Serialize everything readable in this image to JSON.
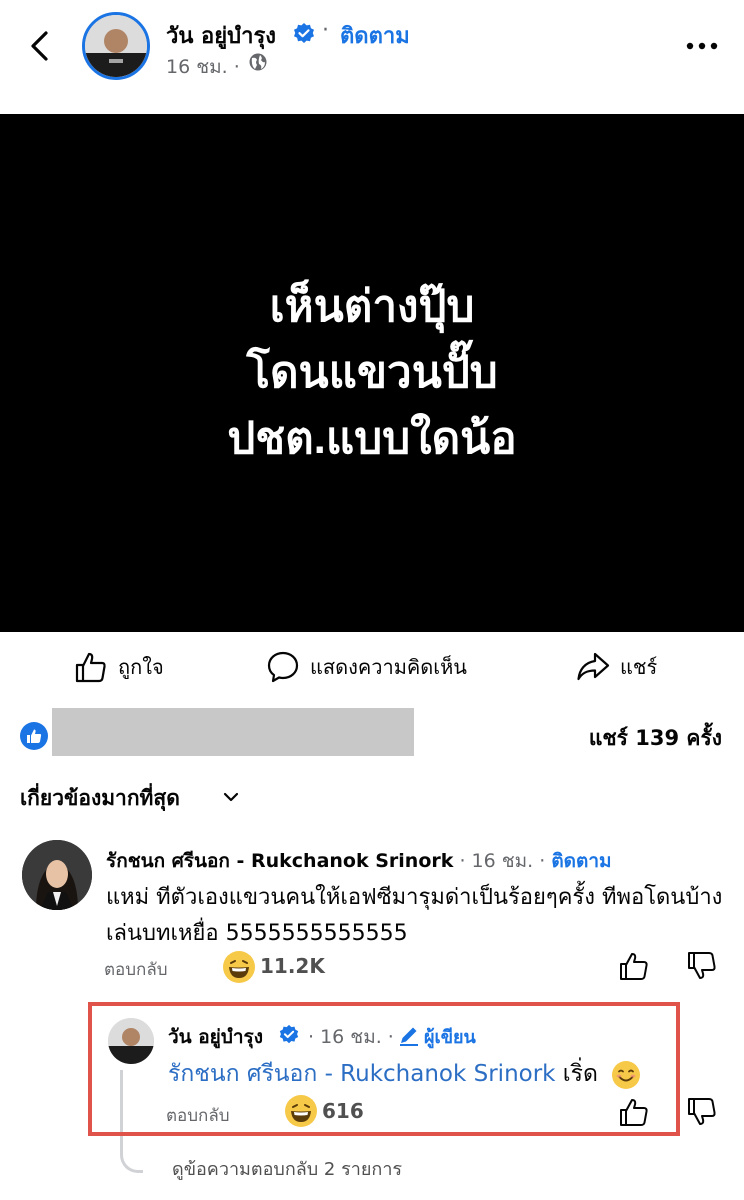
{
  "header": {
    "author_name": "วัน อยู่บำรุง",
    "follow_label": "ติดตาม",
    "separator": "·",
    "timestamp": "16 ชม.",
    "timestamp_dot": "·"
  },
  "post": {
    "image_lines": [
      "เห็นต่างปุ๊บ",
      "โดนแขวนปั๊บ",
      "ปชต.แบบใดน้อ"
    ]
  },
  "actions": {
    "like_label": "ถูกใจ",
    "comment_label": "แสดงความคิดเห็น",
    "share_label": "แชร์"
  },
  "stats": {
    "share_count": "แชร์ 139 ครั้ง"
  },
  "comments": {
    "sort_label": "เกี่ยวข้องมากที่สุด",
    "items": [
      {
        "author": "รักชนก ศรีนอก - Rukchanok Srinork",
        "time": "· 16 ชม. ·",
        "follow_label": "ติดตาม",
        "text": "แหม่ ทีตัวเองแขวนคนให้เอฟซีมารุมด่าเป็นร้อยๆครั้ง ทีพอโดนบ้างเล่นบทเหยื่อ 5555555555555",
        "reply_label": "ตอบกลับ",
        "reaction_count": "11.2K",
        "reply": {
          "author": "วัน อยู่บำรุง",
          "time": "· 16 ชม. ·",
          "badge": "ผู้เขียน",
          "mention": "รักชนก ศรีนอก - Rukchanok Srinork",
          "text": " เริ่ด",
          "reply_label": "ตอบกลับ",
          "reaction_count": "616"
        },
        "view_replies": "ดูข้อความตอบกลับ 2 รายการ"
      }
    ]
  },
  "colors": {
    "accent": "#1b74e4",
    "highlight_border": "#e0534a"
  }
}
